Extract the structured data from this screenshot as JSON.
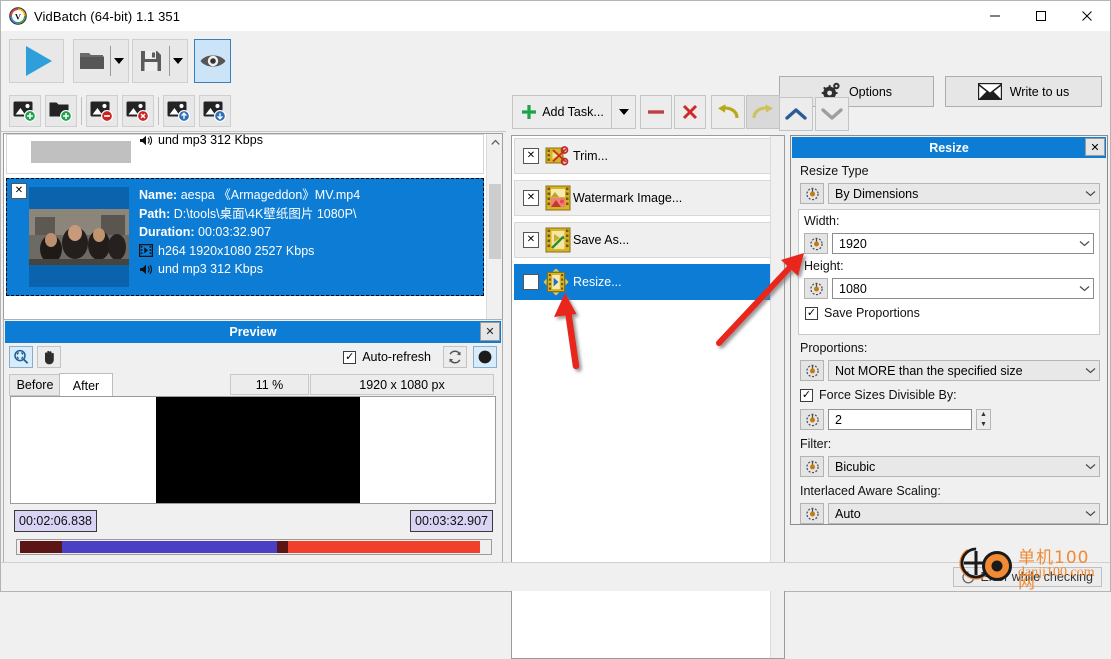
{
  "window": {
    "title": "VidBatch (64-bit) 1.1 351",
    "app_icon": "vidbatch-logo-icon",
    "minimize": "—",
    "maximize": "☐",
    "close": "✕"
  },
  "main_toolbar": {
    "run_button": "play-icon",
    "open_button": "open-folder-icon",
    "save_button": "save-disk-icon",
    "preview_toggle": "eye-icon",
    "options_label": "Options",
    "options_icon": "gear-icon",
    "write_label": "Write to us",
    "write_icon": "envelope-icon"
  },
  "file_toolbar": {
    "buttons": [
      {
        "name": "add-file",
        "icon": "image-plus-icon"
      },
      {
        "name": "add-folder",
        "icon": "folder-plus-icon"
      },
      {
        "name": "remove-file",
        "icon": "image-minus-icon"
      },
      {
        "name": "remove-all-files",
        "icon": "image-delete-icon"
      },
      {
        "name": "move-file-up",
        "icon": "image-up-icon"
      },
      {
        "name": "move-file-down",
        "icon": "image-down-icon"
      }
    ]
  },
  "file_list": {
    "partial_item": {
      "audio_line": "und mp3 312 Kbps",
      "audio_icon": "speaker-icon"
    },
    "selected_item": {
      "checkbox": "✕",
      "name_label": "Name:",
      "name_value": "aespa 《Armageddon》MV.mp4",
      "path_label": "Path:",
      "path_value": "D:\\tools\\桌面\\4K壁纸图片 1080P\\",
      "duration_label": "Duration:",
      "duration_value": "00:03:32.907",
      "video_icon": "film-icon",
      "video_line": "h264 1920x1080 2527 Kbps",
      "audio_icon": "speaker-icon",
      "audio_line": "und mp3 312 Kbps"
    },
    "scroll_up": "⌃",
    "scroll_down": "⌄"
  },
  "preview": {
    "title": "Preview",
    "close": "✕",
    "zoom_tool_icon": "zoom-fit-icon",
    "pan_tool_icon": "hand-icon",
    "auto_refresh_label": "Auto-refresh",
    "auto_refresh_checked": "✓",
    "refresh_icon": "refresh-icon",
    "record_icon": "record-dot-icon",
    "tab_before": "Before",
    "tab_after": "After",
    "zoom_value": "11 %",
    "size_value": "1920 x 1080 px",
    "time_current": "00:02:06.838",
    "time_total": "00:03:32.907"
  },
  "tasks": {
    "toolbar": {
      "add_task_label": "Add Task...",
      "add_task_icon": "plus-icon",
      "add_task_dropdown": "caret-down-icon",
      "remove_icon": "minus-icon",
      "delete_icon": "x-red-icon",
      "undo_icon": "undo-arrow-icon",
      "redo_icon": "redo-arrow-icon",
      "move_up_icon": "chevron-up-icon",
      "move_down_icon": "chevron-down-icon"
    },
    "items": [
      {
        "checkbox": "✕",
        "icon": "trim-scissors-icon",
        "label": "Trim...",
        "selected": false
      },
      {
        "checkbox": "✕",
        "icon": "watermark-image-icon",
        "label": "Watermark Image...",
        "selected": false
      },
      {
        "checkbox": "✕",
        "icon": "save-as-icon",
        "label": "Save As...",
        "selected": false
      },
      {
        "checkbox": "✕",
        "icon": "resize-icon",
        "label": "Resize...",
        "selected": true
      }
    ]
  },
  "resize_panel": {
    "title": "Resize",
    "close": "✕",
    "resize_type_label": "Resize Type",
    "resize_type_value": "By Dimensions",
    "width_label": "Width:",
    "width_value": "1920",
    "height_label": "Height:",
    "height_value": "1080",
    "save_proportions_label": "Save Proportions",
    "save_proportions_checked": "✓",
    "proportions_label": "Proportions:",
    "proportions_value": "Not MORE than the specified size",
    "force_divisible_label": "Force Sizes Divisible By:",
    "force_divisible_checked": "✓",
    "force_divisible_value": "2",
    "filter_label": "Filter:",
    "filter_value": "Bicubic",
    "interlaced_label": "Interlaced Aware Scaling:",
    "interlaced_value": "Auto",
    "knob_icon": "preset-knob-icon",
    "dropdown_icon": "chevron-down-icon"
  },
  "status_bar": {
    "spinner_icon": "spinner-icon",
    "message": "Error while checking"
  },
  "watermark": {
    "logo_icon": "danji100-logo-icon",
    "line1": "单机100网",
    "line2": "danji100.com"
  },
  "annotations": {
    "arrow1": "red-arrow-pointing-to-resize-task",
    "arrow2": "red-arrow-pointing-to-width-knob"
  },
  "colors": {
    "accent_blue": "#0c7cd5",
    "play_blue": "#2f9fdc",
    "window_bg": "#f0f0f0",
    "annotation_red": "#e8251b",
    "watermark_orange": "#f08a35"
  }
}
